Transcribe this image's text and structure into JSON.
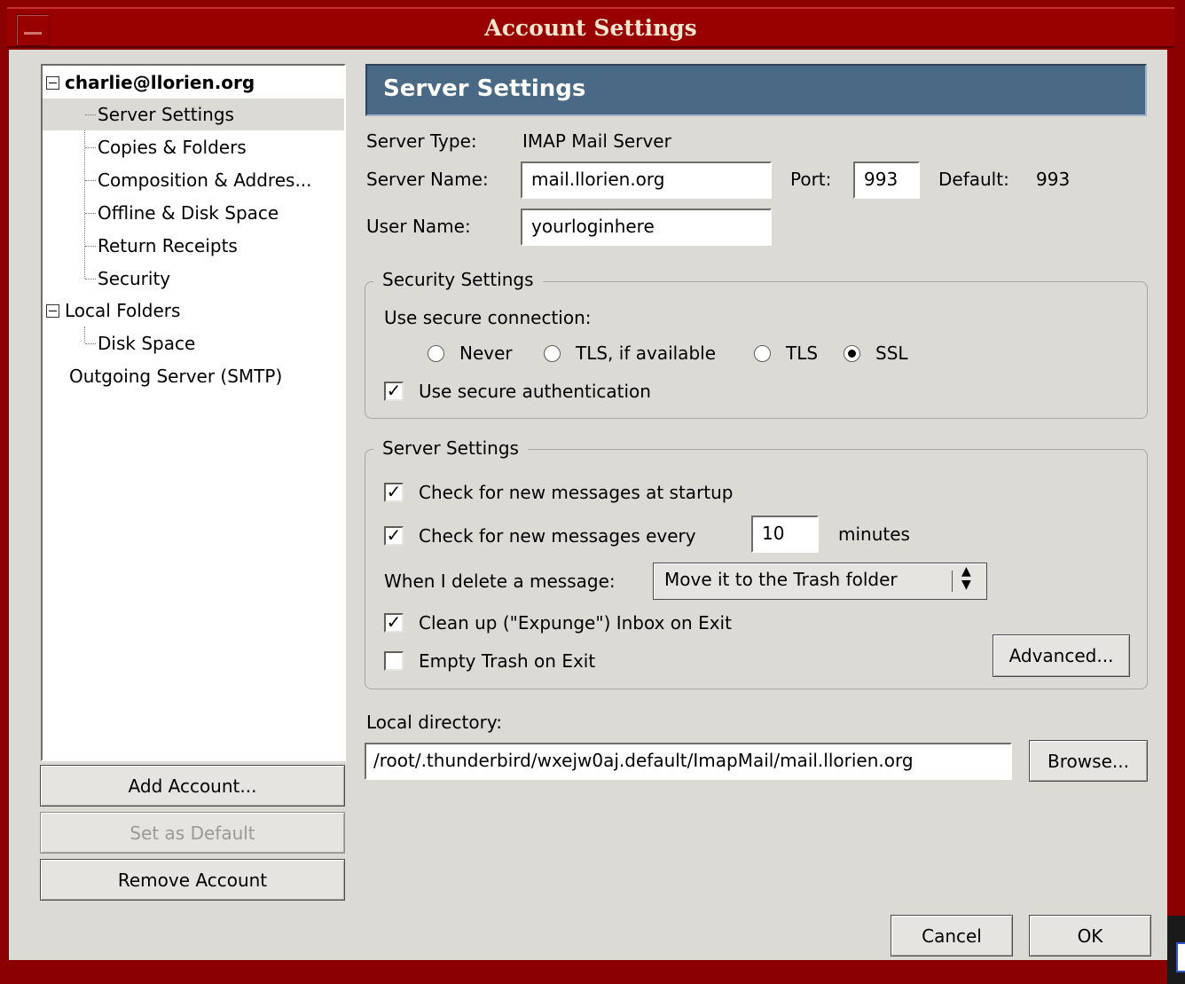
{
  "window": {
    "title": "Account Settings"
  },
  "tree": {
    "account": "charlie@llorien.org",
    "account_items": [
      "Server Settings",
      "Copies & Folders",
      "Composition & Addres...",
      "Offline & Disk Space",
      "Return Receipts",
      "Security"
    ],
    "local_folders": "Local Folders",
    "local_items": [
      "Disk Space"
    ],
    "outgoing": "Outgoing Server (SMTP)"
  },
  "left_buttons": {
    "add": "Add Account...",
    "default": "Set as Default",
    "remove": "Remove Account"
  },
  "panel": {
    "header": "Server Settings",
    "server_type_label": "Server Type:",
    "server_type_value": "IMAP Mail Server",
    "server_name_label": "Server Name:",
    "server_name_value": "mail.llorien.org",
    "port_label": "Port:",
    "port_value": "993",
    "default_label": "Default:",
    "default_value": "993",
    "user_name_label": "User Name:",
    "user_name_value": "yourloginhere"
  },
  "security": {
    "legend": "Security Settings",
    "use_secure": "Use secure connection:",
    "options": [
      "Never",
      "TLS, if available",
      "TLS",
      "SSL"
    ],
    "selected": "SSL",
    "secure_auth": "Use secure authentication",
    "secure_auth_checked": true
  },
  "server": {
    "legend": "Server Settings",
    "check_startup": "Check for new messages at startup",
    "check_every": "Check for new messages every",
    "interval": "10",
    "minutes": "minutes",
    "delete_label": "When I delete a message:",
    "delete_value": "Move it to the Trash folder",
    "expunge": "Clean up (\"Expunge\") Inbox on Exit",
    "empty_trash": "Empty Trash on Exit",
    "advanced": "Advanced..."
  },
  "local_dir": {
    "label": "Local directory:",
    "path": "/root/.thunderbird/wxejw0aj.default/ImapMail/mail.llorien.org",
    "browse": "Browse..."
  },
  "footer": {
    "cancel": "Cancel",
    "ok": "OK"
  }
}
